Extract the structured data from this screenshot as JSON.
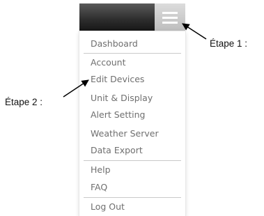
{
  "header": {
    "menu_button_icon": "hamburger-menu-icon"
  },
  "menu": {
    "items": [
      {
        "label": "Dashboard"
      },
      {
        "label": "Account"
      },
      {
        "label": "Edit Devices"
      },
      {
        "label": "Unit & Display"
      },
      {
        "label": "Alert Setting"
      },
      {
        "label": "Weather Server"
      },
      {
        "label": "Data Export"
      },
      {
        "label": "Help"
      },
      {
        "label": "FAQ"
      },
      {
        "label": "Log Out"
      }
    ]
  },
  "annotations": {
    "step1_label": "Étape 1 :",
    "step2_label": "Étape 2 :"
  }
}
